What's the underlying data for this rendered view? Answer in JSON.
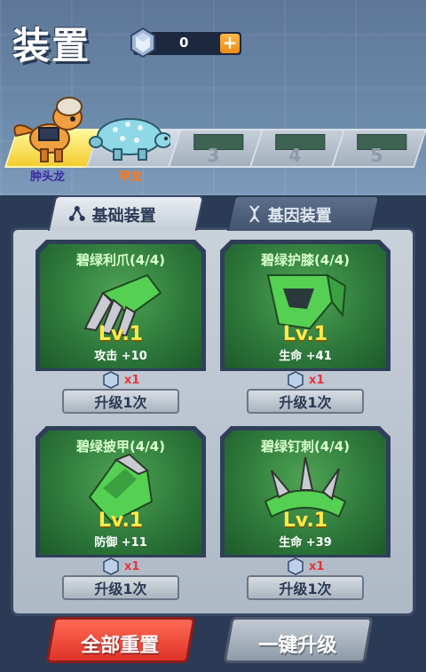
{
  "header": {
    "title": "装置",
    "currency": {
      "icon": "gem-icon",
      "count": "0",
      "add_label": "+"
    }
  },
  "dino_slots": [
    {
      "name": "肿头龙",
      "selected": true,
      "name_color": "#3b2aa8"
    },
    {
      "name": "甲龙",
      "selected": false,
      "name_color": "#ff7a1a"
    },
    {
      "number": "3"
    },
    {
      "number": "4"
    },
    {
      "number": "5"
    }
  ],
  "tabs": [
    {
      "label": "基础装置",
      "active": true
    },
    {
      "label": "基因装置",
      "active": false
    }
  ],
  "equipment": [
    {
      "name": "碧绿利爪(4/4)",
      "level": "Lv.1",
      "stat": "攻击 +10",
      "cost": "x1",
      "upgrade_label": "升级1次",
      "icon": "claw-icon"
    },
    {
      "name": "碧绿护膝(4/4)",
      "level": "Lv.1",
      "stat": "生命 +41",
      "cost": "x1",
      "upgrade_label": "升级1次",
      "icon": "kneepad-icon"
    },
    {
      "name": "碧绿披甲(4/4)",
      "level": "Lv.1",
      "stat": "防御 +11",
      "cost": "x1",
      "upgrade_label": "升级1次",
      "icon": "armor-icon"
    },
    {
      "name": "碧绿钉刺(4/4)",
      "level": "Lv.1",
      "stat": "生命 +39",
      "cost": "x1",
      "upgrade_label": "升级1次",
      "icon": "spike-icon"
    }
  ],
  "actions": {
    "reset_all_label": "全部重置",
    "one_key_upgrade_label": "一键升级"
  },
  "colors": {
    "accent_green": "#2f7a3c",
    "level_yellow": "#ffe94a",
    "cost_red": "#e8333a",
    "reset_red": "#e0332a"
  }
}
